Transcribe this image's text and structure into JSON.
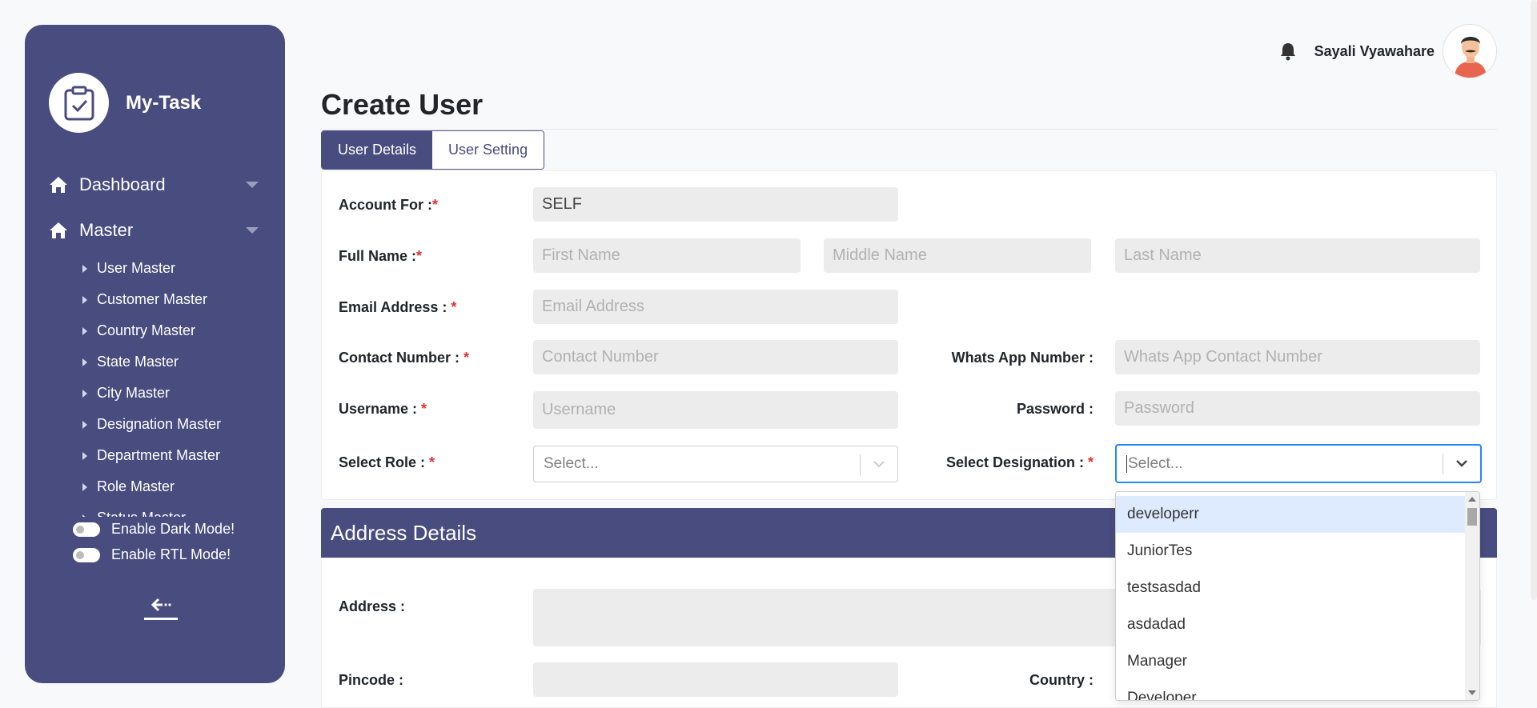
{
  "colors": {
    "primary": "#484c7f",
    "required": "#e03131",
    "focus": "#2684ff",
    "highlight": "#deebff"
  },
  "sidebar": {
    "brand": "My-Task",
    "nav": [
      {
        "label": "Dashboard",
        "icon": "home-icon"
      },
      {
        "label": "Master",
        "icon": "home-icon"
      }
    ],
    "submenu": [
      "User Master",
      "Customer Master",
      "Country Master",
      "State Master",
      "City Master",
      "Designation Master",
      "Department Master",
      "Role Master",
      "Status Master"
    ],
    "toggles": [
      "Enable Dark Mode!",
      "Enable RTL Mode!"
    ]
  },
  "header": {
    "username": "Sayali Vyawahare"
  },
  "page": {
    "title": "Create User"
  },
  "tabs": [
    {
      "label": "User Details",
      "active": true
    },
    {
      "label": "User Setting",
      "active": false
    }
  ],
  "form": {
    "account_for": {
      "label": "Account For :",
      "req": "*",
      "value": "SELF"
    },
    "full_name": {
      "label": "Full Name :",
      "req": "*",
      "first": "First Name",
      "middle": "Middle Name",
      "last": "Last Name"
    },
    "email": {
      "label": "Email Address : ",
      "req": "*",
      "placeholder": "Email Address"
    },
    "contact": {
      "label": "Contact Number : ",
      "req": "*",
      "placeholder": "Contact Number"
    },
    "whatsapp": {
      "label": "Whats App Number :",
      "placeholder": "Whats App Contact Number"
    },
    "username": {
      "label": "Username : ",
      "req": "*",
      "placeholder": "Username"
    },
    "password": {
      "label": "Password :",
      "placeholder": "Password"
    },
    "role": {
      "label": "Select Role : ",
      "req": "*",
      "placeholder": "Select..."
    },
    "designation": {
      "label": "Select Designation : ",
      "req": "*",
      "placeholder": "Select..."
    }
  },
  "address": {
    "title": "Address Details",
    "address_label": "Address :",
    "pincode_label": "Pincode :",
    "country_label": "Country :"
  },
  "designation_options": [
    "developerr",
    "JuniorTes",
    "testsasdad",
    "asdadad",
    "Manager",
    "Developer"
  ]
}
